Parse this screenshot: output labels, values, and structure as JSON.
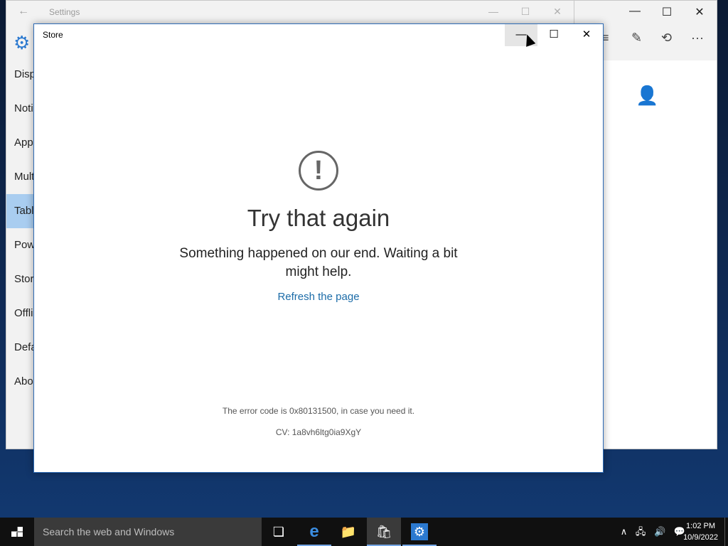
{
  "settings_window": {
    "back_icon": "arrow-left-icon",
    "title": "Settings",
    "gear_icon": "gear-icon",
    "controls": [
      "—",
      "☐",
      "✕"
    ],
    "nav_items": [
      "Disp",
      "Noti",
      "App",
      "Mult",
      "Tabl",
      "Pow",
      "Stor",
      "Offli",
      "Defa",
      "Abo"
    ],
    "active_index": 4
  },
  "right_window": {
    "controls": [
      "—",
      "☐",
      "✕"
    ],
    "tool_icons": [
      "hamburger-icon",
      "note-icon",
      "share-icon",
      "more-icon"
    ],
    "tool_glyphs": [
      "≡",
      "✎",
      "⟲",
      "···"
    ],
    "person_icon": "add-person-icon",
    "person_glyph": "👤"
  },
  "store_window": {
    "title": "Store",
    "minimize_glyph": "—",
    "maximize_glyph": "☐",
    "close_glyph": "✕",
    "error_glyph": "!",
    "heading": "Try that again",
    "message": "Something happened on our end. Waiting a bit might help.",
    "link": "Refresh the page",
    "error_code": "The error code is 0x80131500, in case you need it.",
    "cv": "CV: 1a8vh6ltg0ia9XgY"
  },
  "taskbar": {
    "search_placeholder": "Search the web and Windows",
    "task_view_glyph": "❏",
    "edge_glyph": "e",
    "explorer_glyph": "📁",
    "store_glyph": "🛍",
    "settings_glyph": "⚙",
    "tray_glyphs": [
      "∧",
      "🖧",
      "🔊",
      "💬"
    ],
    "time": "1:02 PM",
    "date": "10/9/2022"
  },
  "colors": {
    "accent": "#2b79d0",
    "link": "#1c6ca8",
    "active_nav": "#a9cdf0"
  }
}
